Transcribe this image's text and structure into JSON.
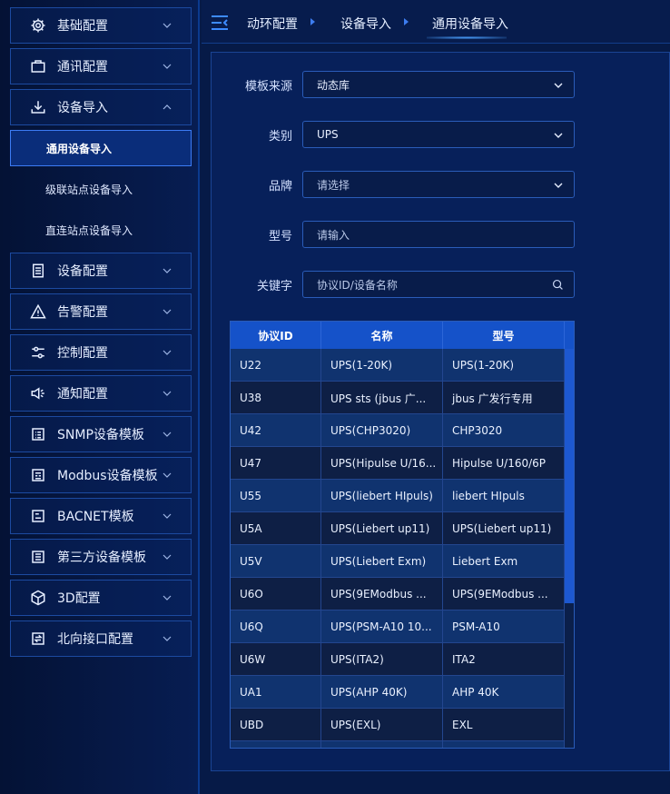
{
  "sidebar": {
    "items": [
      {
        "label": "基础配置",
        "icon": "gear-icon"
      },
      {
        "label": "通讯配置",
        "icon": "briefcase-icon"
      },
      {
        "label": "设备导入",
        "icon": "download-icon"
      },
      {
        "label": "设备配置",
        "icon": "document-list-icon"
      },
      {
        "label": "告警配置",
        "icon": "warning-icon"
      },
      {
        "label": "控制配置",
        "icon": "sliders-icon"
      },
      {
        "label": "通知配置",
        "icon": "speaker-icon"
      },
      {
        "label": "SNMP设备模板",
        "icon": "template-icon"
      },
      {
        "label": "Modbus设备模板",
        "icon": "template-icon"
      },
      {
        "label": "BACNET模板",
        "icon": "template-icon"
      },
      {
        "label": "第三方设备模板",
        "icon": "template-icon"
      },
      {
        "label": "3D配置",
        "icon": "cube-icon"
      },
      {
        "label": "北向接口配置",
        "icon": "interface-icon"
      }
    ],
    "subitems": [
      {
        "label": "通用设备导入",
        "active": true
      },
      {
        "label": "级联站点设备导入",
        "active": false
      },
      {
        "label": "直连站点设备导入",
        "active": false
      }
    ]
  },
  "breadcrumb": {
    "items": [
      "动环配置",
      "设备导入",
      "通用设备导入"
    ]
  },
  "form": {
    "template_source": {
      "label": "模板来源",
      "value": "动态库"
    },
    "category": {
      "label": "类别",
      "value": "UPS"
    },
    "brand": {
      "label": "品牌",
      "placeholder": "请选择"
    },
    "model": {
      "label": "型号",
      "placeholder": "请输入"
    },
    "keyword": {
      "label": "关键字",
      "placeholder": "协议ID/设备名称"
    }
  },
  "table": {
    "columns": [
      "协议ID",
      "名称",
      "型号"
    ],
    "rows": [
      [
        "U22",
        "UPS(1-20K)",
        "UPS(1-20K)"
      ],
      [
        "U38",
        "UPS sts (jbus 广...",
        "jbus 广发行专用"
      ],
      [
        "U42",
        "UPS(CHP3020)",
        "CHP3020"
      ],
      [
        "U47",
        "UPS(Hipulse U/16...",
        "Hipulse U/160/6P"
      ],
      [
        "U55",
        "UPS(liebert HIpuls)",
        "liebert HIpuls"
      ],
      [
        "U5A",
        "UPS(Liebert up11)",
        "UPS(Liebert up11)"
      ],
      [
        "U5V",
        "UPS(Liebert Exm)",
        "Liebert Exm"
      ],
      [
        "U6O",
        "UPS(9EModbus ...",
        "UPS(9EModbus ..."
      ],
      [
        "U6Q",
        "UPS(PSM-A10 10...",
        "PSM-A10"
      ],
      [
        "U6W",
        "UPS(ITA2)",
        "ITA2"
      ],
      [
        "UA1",
        "UPS(AHP 40K)",
        "AHP 40K"
      ],
      [
        "UBD",
        "UPS(EXL)",
        "EXL"
      ],
      [
        "",
        "",
        ""
      ]
    ]
  },
  "colors": {
    "background": "#061a47",
    "accent": "#1552c9",
    "active_border": "#3c7cf5"
  }
}
